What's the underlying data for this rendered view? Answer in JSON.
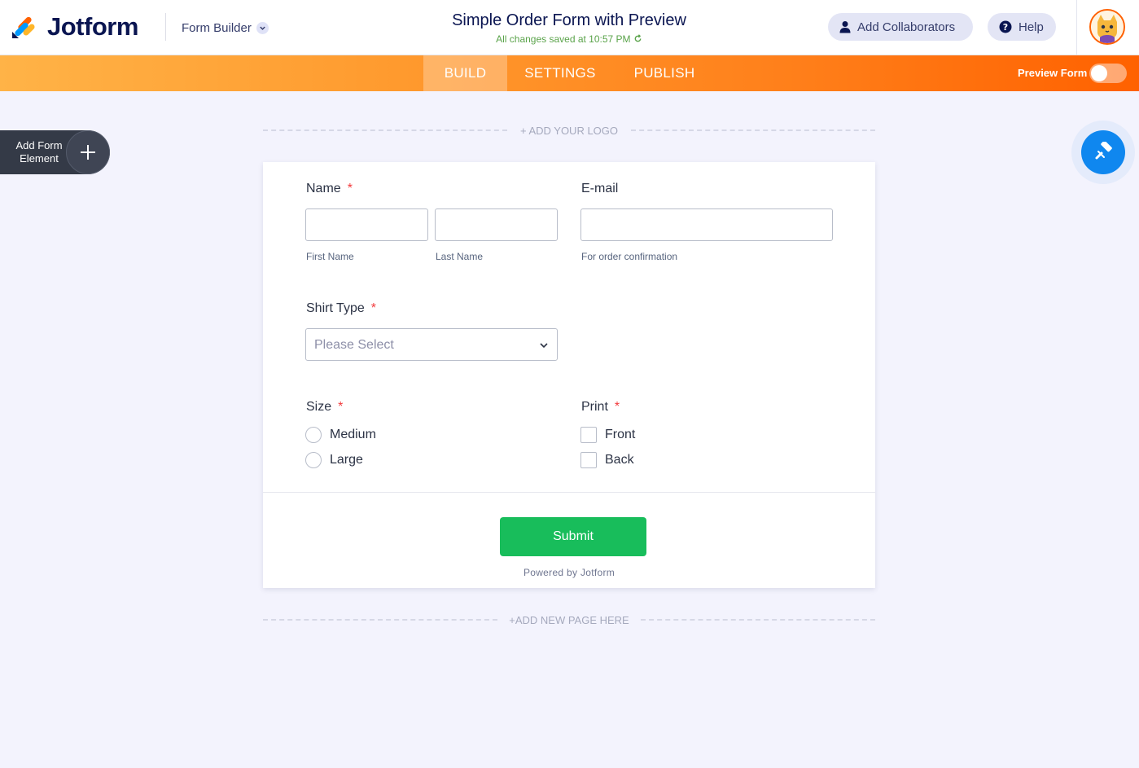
{
  "header": {
    "logo_text": "Jotform",
    "builder_label": "Form Builder",
    "form_title": "Simple Order Form with Preview",
    "save_status": "All changes saved at 10:57 PM",
    "collaborators_label": "Add Collaborators",
    "help_label": "Help"
  },
  "nav": {
    "tabs": [
      {
        "label": "BUILD",
        "active": true
      },
      {
        "label": "SETTINGS",
        "active": false
      },
      {
        "label": "PUBLISH",
        "active": false
      }
    ],
    "preview_label": "Preview Form",
    "preview_enabled": false
  },
  "sidebar": {
    "add_element_line1": "Add Form",
    "add_element_line2": "Element"
  },
  "canvas": {
    "add_logo": "+ ADD YOUR LOGO",
    "add_page": "+ADD NEW PAGE HERE"
  },
  "form": {
    "name": {
      "label": "Name",
      "required": "*",
      "first_sub": "First Name",
      "last_sub": "Last Name"
    },
    "email": {
      "label": "E-mail",
      "sub": "For order confirmation"
    },
    "shirt_type": {
      "label": "Shirt Type",
      "required": "*",
      "placeholder": "Please Select"
    },
    "size": {
      "label": "Size",
      "required": "*",
      "options": [
        "Medium",
        "Large"
      ]
    },
    "print": {
      "label": "Print",
      "required": "*",
      "options": [
        "Front",
        "Back"
      ]
    },
    "submit_label": "Submit",
    "powered_by": "Powered by Jotform"
  },
  "colors": {
    "brand_navy": "#0a1551",
    "orange": "#ff6100",
    "submit_green": "#18bd5b",
    "designer_blue": "#0f87ef",
    "required_red": "#f23a3c"
  },
  "icons": {
    "builder_dropdown": "chevron-down-icon",
    "save": "refresh-icon",
    "collaborators": "user-icon",
    "help": "question-circle-icon",
    "add_element": "plus-icon",
    "designer": "paint-roller-icon",
    "select": "chevron-down-icon"
  }
}
